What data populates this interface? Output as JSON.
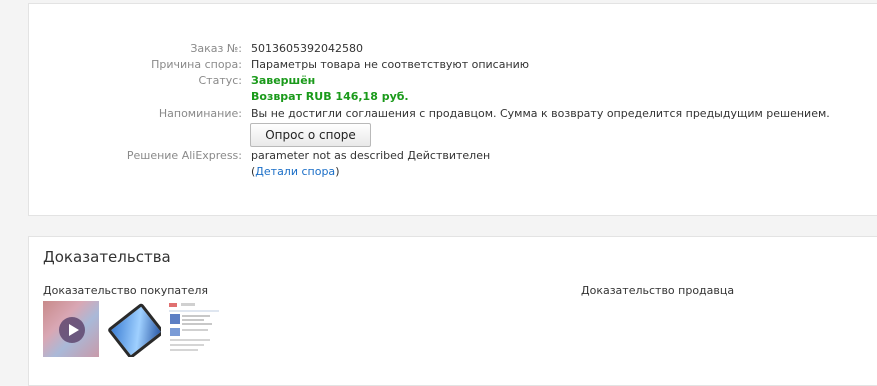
{
  "dispute": {
    "order_label": "Заказ №:",
    "order_value": "5013605392042580",
    "reason_label": "Причина спора:",
    "reason_value": "Параметры товара не соответствуют описанию",
    "status_label": "Статус:",
    "status_value": "Завершён",
    "refund_value": "Возврат RUB 146,18 руб.",
    "reminder_label": "Напоминание:",
    "reminder_value": "Вы не достигли соглашения с продавцом. Сумма к возврату определится предыдущим решением.",
    "survey_button": "Опрос о споре",
    "decision_label": "Решение AliExpress:",
    "decision_value": "parameter not as described  Действителен",
    "details_open": "(",
    "details_link": "Детали спора",
    "details_close": ")"
  },
  "evidence": {
    "title": "Доказательства",
    "buyer_label": "Доказательство покупателя",
    "seller_label": "Доказательство продавца"
  },
  "colors": {
    "status_green": "#1a9a1a",
    "link_blue": "#1a6ec7"
  }
}
